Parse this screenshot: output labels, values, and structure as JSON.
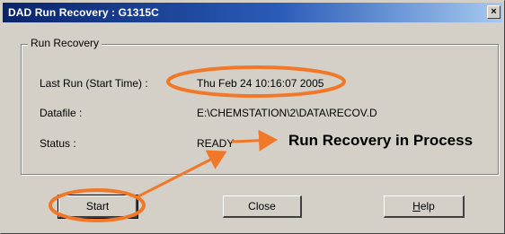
{
  "window": {
    "title": "DAD Run Recovery : G1315C",
    "close_glyph": "×"
  },
  "group": {
    "label": "Run Recovery",
    "fields": [
      {
        "label": "Last Run (Start Time) :",
        "value": "Thu Feb 24 10:16:07 2005"
      },
      {
        "label": "Datafile :",
        "value": "E:\\CHEMSTATION\\2\\DATA\\RECOV.D"
      },
      {
        "label": "Status :",
        "value": "READY"
      }
    ]
  },
  "buttons": {
    "start": "Start",
    "close": "Close",
    "help_mnemonic": "H",
    "help_rest": "elp"
  },
  "annotation": {
    "text": "Run Recovery in Process",
    "color": "#f07828"
  }
}
